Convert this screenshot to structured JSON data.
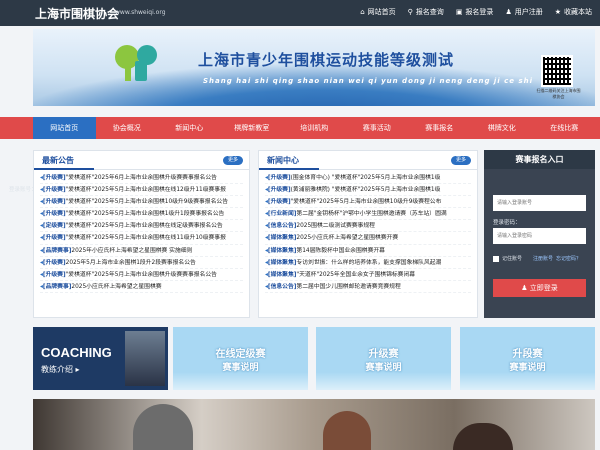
{
  "topbar": {
    "title": "上海市围棋协会",
    "url": "www.shweiqi.org",
    "links": [
      {
        "label": "网站首页",
        "icon": "home-icon"
      },
      {
        "label": "报名查询",
        "icon": "search-icon"
      },
      {
        "label": "报名登录",
        "icon": "lock-icon"
      },
      {
        "label": "用户注册",
        "icon": "user-icon"
      },
      {
        "label": "收藏本站",
        "icon": "star-icon"
      }
    ]
  },
  "banner": {
    "title": "上海市青少年围棋运动技能等级测试",
    "subtitle": "Shang hai shi qing shao nian wei qi yun dong ji neng deng ji ce shi",
    "qr_caption": "扫描二维码关注上海市围棋协会"
  },
  "nav": {
    "items": [
      "网站首页",
      "协会概况",
      "新闻中心",
      "棋牌新教室",
      "培训机构",
      "赛事活动",
      "赛事报名",
      "棋牌文化",
      "在线比赛"
    ],
    "active_index": 0
  },
  "announcements": {
    "title": "最新公告",
    "more": "更多",
    "items": [
      {
        "tag": "[升级赛]",
        "text": "\"爱棋道杯\"2025年6月上海市业余围棋升级赛赛事报名公告"
      },
      {
        "tag": "[升级赛]",
        "text": "\"爱棋道杯\"2025年5月上海市业余围棋在线12级升11级赛事报"
      },
      {
        "tag": "[升级赛]",
        "text": "\"爱棋道杯\"2025年5月上海市业余围棋10级升9级赛事报名公告"
      },
      {
        "tag": "[升级赛]",
        "text": "\"爱棋道杯\"2025年5月上海市业余围棋1级升1段赛事报名公告"
      },
      {
        "tag": "[定级赛]",
        "text": "\"爱棋道杯\"2025年5月上海市业余围棋在线定级赛事报名公告"
      },
      {
        "tag": "[升级赛]",
        "text": "\"爱棋道杯\"2025年5月上海市业余围棋在线11级升10级赛事报"
      },
      {
        "tag": "[品牌赛事]",
        "text": "2025年小应氏杯上海希望之星围棋赛 实施细则"
      },
      {
        "tag": "[升级赛]",
        "text": "2025年5月上海市业余围棋1段升2段赛事报名公告"
      },
      {
        "tag": "[升级赛]",
        "text": "\"爱棋道杯\"2025年5月上海市业余围棋升级赛赛事报名公告"
      },
      {
        "tag": "[品牌赛事]",
        "text": "2025小应氏杯上海希望之星围棋赛"
      }
    ]
  },
  "news": {
    "title": "新闻中心",
    "more": "更多",
    "items": [
      {
        "tag": "[升级赛]",
        "text": "(围金体育中心) \"爱棋道杯\"2025年5月上海市业余围棋1级"
      },
      {
        "tag": "[升级赛]",
        "text": "(黄浦丽雅棋院) \"爱棋道杯\"2025年5月上海市业余围棋1级"
      },
      {
        "tag": "[升级赛]",
        "text": "\"爱棋道杯\"2025年5月上海市业余围棋10级升9级赛程公布"
      },
      {
        "tag": "[行业新闻]",
        "text": "第二届\"金钥杨杯\"沪鄂中小学生围棋邀请赛（苏车站）圆满"
      },
      {
        "tag": "[信息公告]",
        "text": "2025围棋二级测试赛赛事规程"
      },
      {
        "tag": "[媒体聚焦]",
        "text": "2025小应氏杯上海希望之星围棋赛开赛"
      },
      {
        "tag": "[媒体聚焦]",
        "text": "第14届陈毅杯中国业余围棋赛开幕"
      },
      {
        "tag": "[媒体聚焦]",
        "text": "专访刘世振：什么样的培养体系，能支撑国象梯队风起潮"
      },
      {
        "tag": "[媒体聚焦]",
        "text": "\"天道杯\"2025年全国业余女子围棋锦标赛闭幕"
      },
      {
        "tag": "[信息公告]",
        "text": "第二届中国少儿围棋邮轮邀请赛竞赛规程"
      }
    ]
  },
  "login": {
    "title": "赛事报名入口",
    "account_label": "登录账号：",
    "account_placeholder": "请输入登录账号",
    "password_label": "登录密码：",
    "password_placeholder": "请输入登录密码",
    "remember": "记住账号",
    "register": "注册账号",
    "forgot": "忘记密码？",
    "submit": "立即登录"
  },
  "tiles": [
    {
      "line1": "COACHING",
      "line2": "教练介绍 ▸"
    },
    {
      "line1": "在线定级赛",
      "line2": "赛事说明"
    },
    {
      "line1": "升级赛",
      "line2": "赛事说明"
    },
    {
      "line1": "升段赛",
      "line2": "赛事说明"
    }
  ]
}
